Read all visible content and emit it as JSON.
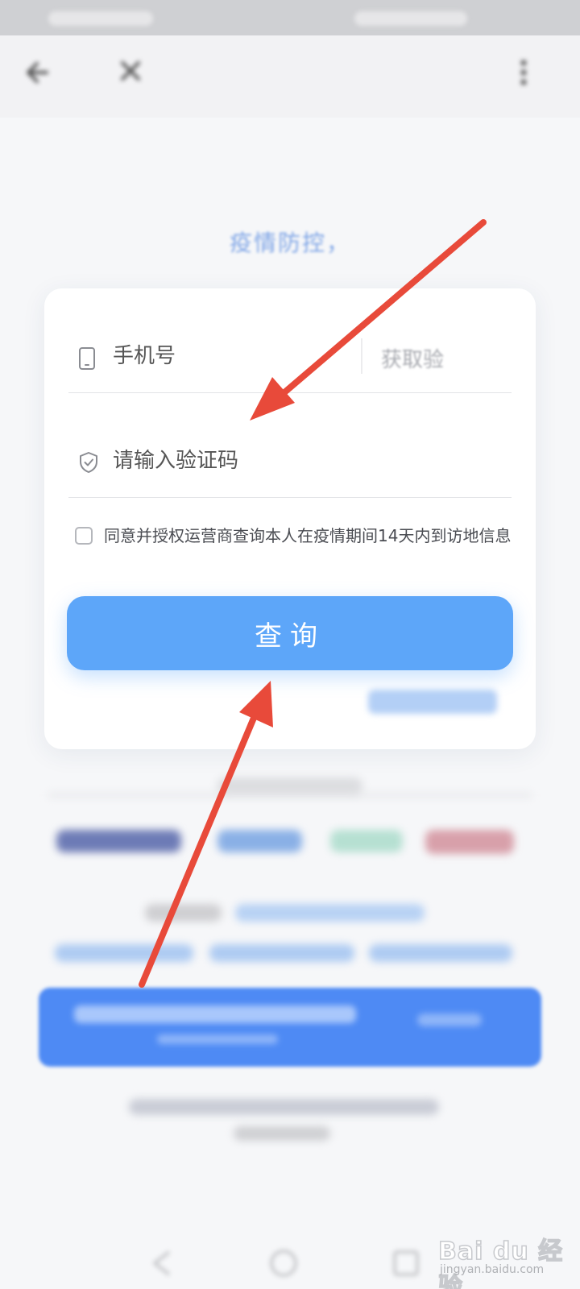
{
  "nav": {
    "back_icon": "arrow-left-icon",
    "close_icon": "close-icon",
    "title": "",
    "feedback_label": "",
    "more_icon": "more-vertical-icon"
  },
  "hero": {
    "title": "",
    "subtitle": "疫情防控，"
  },
  "form": {
    "phone_icon": "phone-icon",
    "phone_placeholder": "手机号",
    "get_code_label": "获取验",
    "code_icon": "shield-icon",
    "code_placeholder": "请输入验证码",
    "agree_text": "同意并授权运营商查询本人在疫情期间14天内到访地信息",
    "query_button": "查询",
    "help_link": ""
  },
  "watermark": {
    "logo": "Bai du 经验",
    "sub": "jingyan.baidu.com"
  },
  "colors": {
    "accent": "#5da6f9",
    "brand_blue": "#1b5ad8",
    "banner_blue": "#4e8af4",
    "annotation_arrow": "#e84a3a"
  }
}
